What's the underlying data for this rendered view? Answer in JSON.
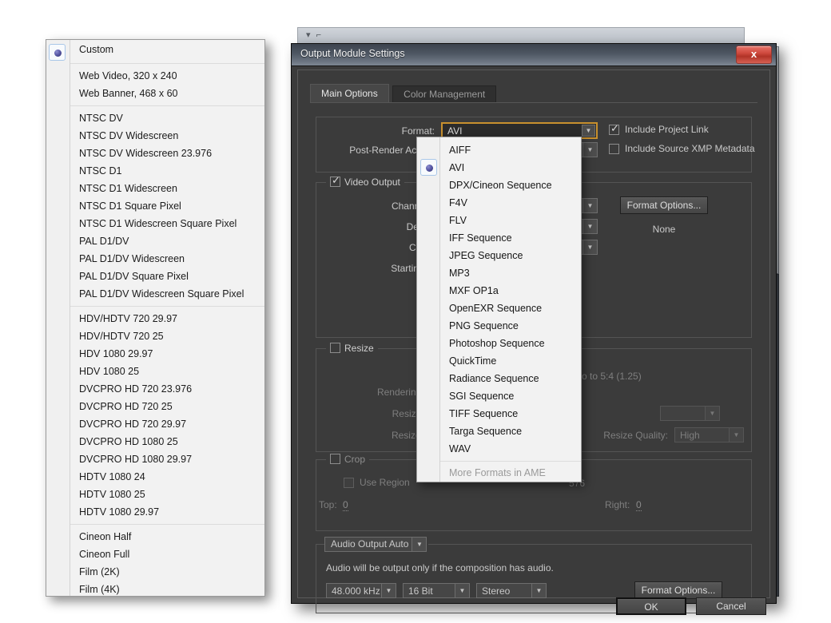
{
  "ghost_window": {
    "glyphs": "▾ ⌐"
  },
  "preset_panel": {
    "selected": "Custom",
    "groups": [
      {
        "items": [
          "Custom"
        ]
      },
      {
        "items": [
          "Web Video, 320 x 240",
          "Web Banner, 468 x 60"
        ]
      },
      {
        "items": [
          "NTSC DV",
          "NTSC DV Widescreen",
          "NTSC DV Widescreen 23.976",
          "NTSC D1",
          "NTSC D1 Widescreen",
          "NTSC D1 Square Pixel",
          "NTSC D1 Widescreen Square Pixel",
          "PAL D1/DV",
          "PAL D1/DV Widescreen",
          "PAL D1/DV Square Pixel",
          "PAL D1/DV Widescreen Square Pixel"
        ]
      },
      {
        "items": [
          "HDV/HDTV 720 29.97",
          "HDV/HDTV 720 25",
          "HDV 1080 29.97",
          "HDV 1080 25",
          "DVCPRO HD 720 23.976",
          "DVCPRO HD 720 25",
          "DVCPRO HD 720 29.97",
          "DVCPRO HD 1080 25",
          "DVCPRO HD 1080 29.97",
          "HDTV 1080 24",
          "HDTV 1080 25",
          "HDTV 1080 29.97"
        ]
      },
      {
        "items": [
          "Cineon Half",
          "Cineon Full",
          "Film (2K)",
          "Film (4K)"
        ]
      }
    ]
  },
  "dialog": {
    "title": "Output Module Settings",
    "close_label": "x",
    "tabs": [
      {
        "label": "Main Options",
        "active": true
      },
      {
        "label": "Color Management",
        "active": false
      }
    ],
    "format_section": {
      "format_label": "Format:",
      "format_value": "AVI",
      "post_render_label": "Post-Render Action:",
      "include_project_link_label": "Include Project Link",
      "include_project_link_checked": true,
      "include_xmp_label": "Include Source XMP Metadata",
      "include_xmp_checked": false
    },
    "video_section": {
      "title": "Video Output",
      "checked": true,
      "channels_label": "Channels:",
      "depth_label": "Depth:",
      "color_label": "Color:",
      "starting_label": "Starting #:",
      "format_options_button": "Format Options...",
      "format_options_value": "None"
    },
    "resize_section": {
      "title": "Resize",
      "checked": false,
      "rendering_at_label": "Rendering at:",
      "resize_to_label": "Resize to:",
      "resize_pct_label": "Resize %:",
      "lock_aspect_label": "o to 5:4 (1.25)",
      "resize_quality_label": "Resize Quality:",
      "resize_quality_value": "High"
    },
    "crop_section": {
      "title": "Crop",
      "checked": false,
      "use_region_label": "Use Region",
      "top_label": "Top:",
      "top_value": "0",
      "right_label": "Right:",
      "right_value": "0",
      "partial_value": "576"
    },
    "audio_section": {
      "header": "Audio Output Auto",
      "note": "Audio will be output only if the composition has audio.",
      "sample_rate": "48.000 kHz",
      "bit_depth": "16 Bit",
      "channels": "Stereo",
      "format_options_button": "Format Options..."
    },
    "footer": {
      "ok_label": "OK",
      "cancel_label": "Cancel"
    }
  },
  "format_menu": {
    "selected": "AVI",
    "groups": [
      {
        "items": [
          "AIFF",
          "AVI",
          "DPX/Cineon Sequence",
          "F4V",
          "FLV",
          "IFF Sequence",
          "JPEG Sequence",
          "MP3",
          "MXF OP1a",
          "OpenEXR Sequence",
          "PNG Sequence",
          "Photoshop Sequence",
          "QuickTime",
          "Radiance Sequence",
          "SGI Sequence",
          "TIFF Sequence",
          "Targa Sequence",
          "WAV"
        ]
      },
      {
        "items": [
          "More Formats in AME"
        ],
        "disabled": true
      }
    ]
  },
  "colors": {
    "dialog_bg": "#3b3b3b",
    "menu_bg": "#f2f2f2",
    "focus_ring": "#c8902e",
    "close_red": "#cf4a3e",
    "radio_sphere": "#5a5aa8"
  }
}
